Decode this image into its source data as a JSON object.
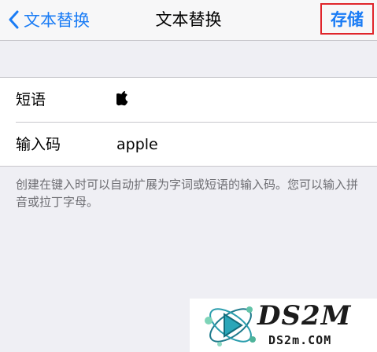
{
  "navbar": {
    "back_label": "文本替换",
    "title": "文本替换",
    "save_label": "存储"
  },
  "form": {
    "phrase_label": "短语",
    "phrase_value": "",
    "shortcut_label": "输入码",
    "shortcut_value": "apple"
  },
  "footnote": "创建在键入时可以自动扩展为字词或短语的输入码。您可以输入拼音或拉丁字母。",
  "watermark": {
    "brand": "DS2M",
    "domain": "DS2m.COM"
  },
  "colors": {
    "accent": "#1a7cf5",
    "highlight_border": "#e0252b",
    "background": "#efeff4"
  },
  "icons": {
    "back": "chevron-left-icon",
    "phrase": "apple-logo-icon"
  }
}
